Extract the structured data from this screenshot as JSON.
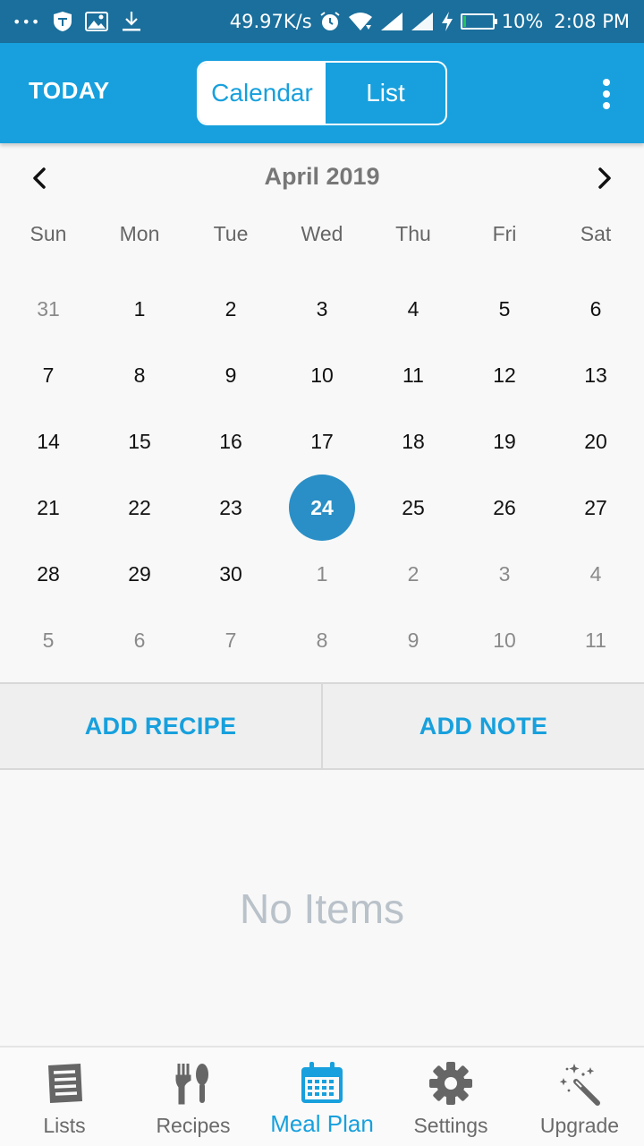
{
  "status_bar": {
    "dots": "•••",
    "speed": "49.97K/s",
    "battery": "10%",
    "battery_level": 0.1,
    "time": "2:08 PM",
    "battery_fill_color": "#22c35e"
  },
  "appbar": {
    "today_label": "TODAY",
    "segments": [
      {
        "label": "Calendar",
        "active": true
      },
      {
        "label": "List",
        "active": false
      }
    ],
    "accent": "#17a0dd"
  },
  "calendar": {
    "month_title": "April 2019",
    "weekdays": [
      "Sun",
      "Mon",
      "Tue",
      "Wed",
      "Thu",
      "Fri",
      "Sat"
    ],
    "weeks": [
      [
        {
          "d": "31",
          "m": true
        },
        {
          "d": "1"
        },
        {
          "d": "2"
        },
        {
          "d": "3"
        },
        {
          "d": "4"
        },
        {
          "d": "5"
        },
        {
          "d": "6"
        }
      ],
      [
        {
          "d": "7"
        },
        {
          "d": "8"
        },
        {
          "d": "9"
        },
        {
          "d": "10"
        },
        {
          "d": "11"
        },
        {
          "d": "12"
        },
        {
          "d": "13"
        }
      ],
      [
        {
          "d": "14"
        },
        {
          "d": "15"
        },
        {
          "d": "16"
        },
        {
          "d": "17"
        },
        {
          "d": "18"
        },
        {
          "d": "19"
        },
        {
          "d": "20"
        }
      ],
      [
        {
          "d": "21"
        },
        {
          "d": "22"
        },
        {
          "d": "23"
        },
        {
          "d": "24",
          "sel": true
        },
        {
          "d": "25"
        },
        {
          "d": "26"
        },
        {
          "d": "27"
        }
      ],
      [
        {
          "d": "28"
        },
        {
          "d": "29"
        },
        {
          "d": "30"
        },
        {
          "d": "1",
          "m": true
        },
        {
          "d": "2",
          "m": true
        },
        {
          "d": "3",
          "m": true
        },
        {
          "d": "4",
          "m": true
        }
      ],
      [
        {
          "d": "5",
          "m": true
        },
        {
          "d": "6",
          "m": true
        },
        {
          "d": "7",
          "m": true
        },
        {
          "d": "8",
          "m": true
        },
        {
          "d": "9",
          "m": true
        },
        {
          "d": "10",
          "m": true
        },
        {
          "d": "11",
          "m": true
        }
      ]
    ],
    "selected_color": "#2a8fc6"
  },
  "actions": {
    "add_recipe": "ADD RECIPE",
    "add_note": "ADD NOTE"
  },
  "empty_state": "No Items",
  "bottom_nav": {
    "items": [
      {
        "label": "Lists",
        "icon": "lists-icon"
      },
      {
        "label": "Recipes",
        "icon": "fork-spoon-icon"
      },
      {
        "label": "Meal Plan",
        "icon": "calendar-icon",
        "active": true
      },
      {
        "label": "Settings",
        "icon": "gear-icon"
      },
      {
        "label": "Upgrade",
        "icon": "magic-wand-icon"
      }
    ]
  }
}
